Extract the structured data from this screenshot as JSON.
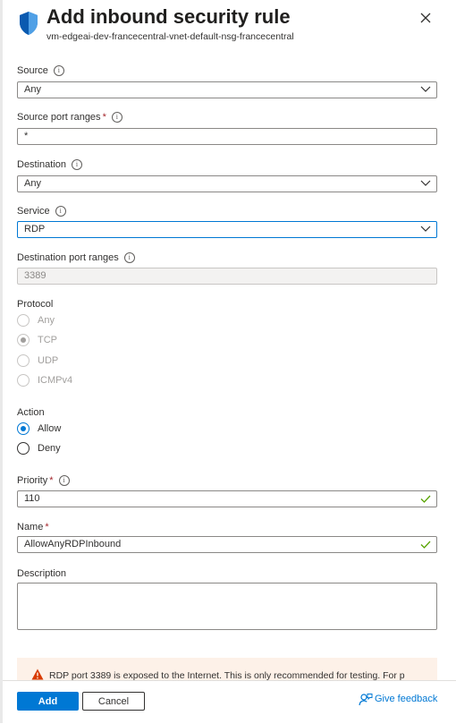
{
  "header": {
    "title": "Add inbound security rule",
    "subtitle": "vm-edgeai-dev-francecentral-vnet-default-nsg-francecentral",
    "close_icon": "close-icon",
    "shield_icon": "shield-icon"
  },
  "form": {
    "source": {
      "label": "Source",
      "value": "Any"
    },
    "source_port_ranges": {
      "label": "Source port ranges",
      "required": "*",
      "value": "*"
    },
    "destination": {
      "label": "Destination",
      "value": "Any"
    },
    "service": {
      "label": "Service",
      "value": "RDP"
    },
    "destination_port_ranges": {
      "label": "Destination port ranges",
      "value": "3389"
    },
    "protocol": {
      "label": "Protocol",
      "options": [
        "Any",
        "TCP",
        "UDP",
        "ICMPv4"
      ],
      "selected": "TCP"
    },
    "action": {
      "label": "Action",
      "options": [
        "Allow",
        "Deny"
      ],
      "selected": "Allow"
    },
    "priority": {
      "label": "Priority",
      "required": "*",
      "value": "110"
    },
    "name": {
      "label": "Name",
      "required": "*",
      "value": "AllowAnyRDPInbound"
    },
    "description": {
      "label": "Description",
      "value": ""
    }
  },
  "warning": {
    "text": "RDP port 3389 is exposed to the Internet. This is only recommended for testing. For p"
  },
  "footer": {
    "add_label": "Add",
    "cancel_label": "Cancel",
    "feedback_label": "Give feedback"
  },
  "colors": {
    "accent": "#0078d4",
    "required": "#a4262c",
    "valid_check": "#57a300",
    "warning_bg": "#fdf1e8",
    "warning_icon": "#d83b01"
  }
}
